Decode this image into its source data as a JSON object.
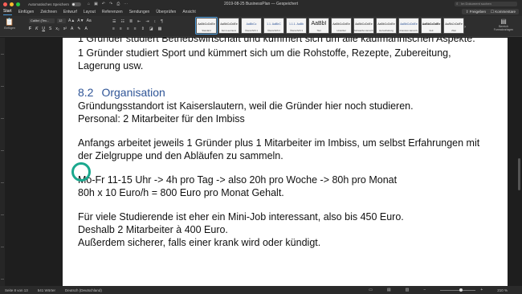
{
  "titlebar": {
    "autosave_label": "Automatisches Speichern",
    "autosave_state": "OFF",
    "document_title": "2019-08-25 BusinessPlan — Gespeichert",
    "search_placeholder": "Im Dokument suchen"
  },
  "tabs": [
    "Start",
    "Einfügen",
    "Zeichnen",
    "Entwurf",
    "Layout",
    "Referenzen",
    "Sendungen",
    "Überprüfen",
    "Ansicht"
  ],
  "active_tab": "Start",
  "share_label": "Freigeben",
  "comments_label": "Kommentare",
  "ribbon": {
    "paste_label": "Einfügen",
    "font_name": "Calibri (Tex...",
    "font_size": "12",
    "styles": [
      {
        "sample": "AaBbCcDdEe",
        "name": "Standard"
      },
      {
        "sample": "AaBbCcDdEe",
        "name": "Kein Leerraum"
      },
      {
        "sample": "AaBbCc",
        "name": "Überschrift 1"
      },
      {
        "sample": "1.1. AaBbC",
        "name": "Überschrift 2"
      },
      {
        "sample": "1.1.1. AaBb",
        "name": "Überschrift 3"
      },
      {
        "sample": "AaBbI",
        "name": "Titel"
      },
      {
        "sample": "AaBbCcDdEe",
        "name": "Untertitel"
      },
      {
        "sample": "AaBbCcDdEe",
        "name": "Schwache Hervorh."
      },
      {
        "sample": "AaBbCcDdEe",
        "name": "Hervorhebung"
      },
      {
        "sample": "AaBbCcDdEe",
        "name": "Intensive Hervorh."
      },
      {
        "sample": "AaBbCcDdEe",
        "name": "Fett"
      },
      {
        "sample": "AaBbCcDdEe",
        "name": "Zitat"
      }
    ],
    "format_pane_label": "Bereich Formatvorlagen"
  },
  "document": {
    "line_top_partial": "1 Gründer studiert Betriebswirtschaft und kümmert sich um alle kaufmännischen Aspekte.",
    "line_1": "1 Gründer studiert Sport und kümmert sich um die Rohstoffe, Rezepte, Zubereitung,",
    "line_2": "Lagerung usw.",
    "heading_number": "8.2",
    "heading_text": "Organisation",
    "line_3": "Gründungsstandort ist Kaiserslautern, weil die Gründer hier noch studieren.",
    "line_4": "Personal: 2 Mitarbeiter für den Imbiss",
    "line_5": "Anfangs arbeitet jeweils 1 Gründer plus 1 Mitarbeiter im Imbiss, um selbst Erfahrungen mit",
    "line_6": "der Zielgruppe und den Abläufen zu sammeln.",
    "line_7": "Mo-Fr 11-15 Uhr -> 4h pro Tag -> also 20h pro Woche -> 80h pro Monat",
    "line_8": "80h x 10 Euro/h = 800 Euro pro Monat Gehalt.",
    "line_9": "Für viele Studierende ist eher ein Mini-Job interessant, also bis 450 Euro.",
    "line_10": "Deshalb 2 Mitarbeiter à 400 Euro.",
    "line_11": "Außerdem sicherer, falls einer krank wird oder kündigt."
  },
  "statusbar": {
    "page": "Seite 8 von 13",
    "words": "541 Wörter",
    "language": "Deutsch (Deutschland)",
    "zoom": "210 %"
  },
  "colors": {
    "heading": "#2f5597",
    "highlight_ring": "#1aa88e",
    "accent": "#4a9bdb"
  }
}
